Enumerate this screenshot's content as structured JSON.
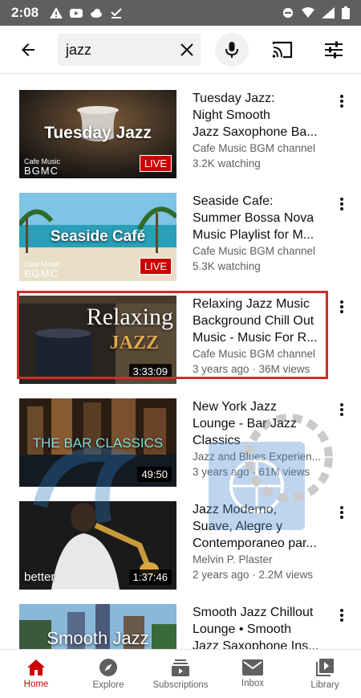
{
  "status_bar": {
    "time": "2:08"
  },
  "search": {
    "query": "jazz"
  },
  "videos": [
    {
      "title_lines": [
        "Tuesday Jazz:",
        "Night Smooth",
        "Jazz Saxophone Ba..."
      ],
      "channel": "Cafe Music BGM channel",
      "meta": "3.2K watching",
      "thumb_text": "Tuesday Jazz",
      "thumb_logo_small": "Cafe Music",
      "thumb_logo_big": "BGMC",
      "badge": "LIVE"
    },
    {
      "title_lines": [
        "Seaside Cafe:",
        "Summer Bossa Nova",
        "Music Playlist for M..."
      ],
      "channel": "Cafe Music BGM channel",
      "meta": "5.3K watching",
      "thumb_text": "Seaside Café",
      "thumb_logo_small": "Cafe Music",
      "thumb_logo_big": "BGMC",
      "badge": "LIVE"
    },
    {
      "title_lines": [
        "Relaxing Jazz Music",
        "Background Chill Out",
        "Music - Music For R..."
      ],
      "channel": "Cafe Music BGM channel",
      "meta": "3 years ago · 36M views",
      "thumb_text": "Relaxing",
      "thumb_text2": "JAZZ",
      "duration": "3:33:09"
    },
    {
      "title_lines": [
        "New York Jazz",
        "Lounge - Bar Jazz",
        "Classics"
      ],
      "channel": "Jazz and Blues Experien...",
      "meta": "3 years ago · 61M views",
      "thumb_text": "THE BAR CLASSICS",
      "duration": "49:50"
    },
    {
      "title_lines": [
        "Jazz Moderno,",
        "Suave, Alegre y",
        "Contemporaneo par..."
      ],
      "channel": "Melvin P. Plaster",
      "meta": "2 years ago · 2.2M views",
      "thumb_text": "better",
      "duration": "1:37:46"
    },
    {
      "title_lines": [
        "Smooth Jazz Chillout",
        "Lounge • Smooth",
        "Jazz Saxophone Ins..."
      ],
      "thumb_text": "Smooth Jazz"
    }
  ],
  "nav": [
    {
      "label": "Home",
      "icon": "home-icon",
      "active": true
    },
    {
      "label": "Explore",
      "icon": "compass-icon"
    },
    {
      "label": "Subscriptions",
      "icon": "subscriptions-icon"
    },
    {
      "label": "Inbox",
      "icon": "inbox-icon"
    },
    {
      "label": "Library",
      "icon": "library-icon"
    }
  ],
  "colors": {
    "accent": "#cc0000",
    "highlight_border": "#d42a2a",
    "status_bar": "#5f5f5f"
  }
}
